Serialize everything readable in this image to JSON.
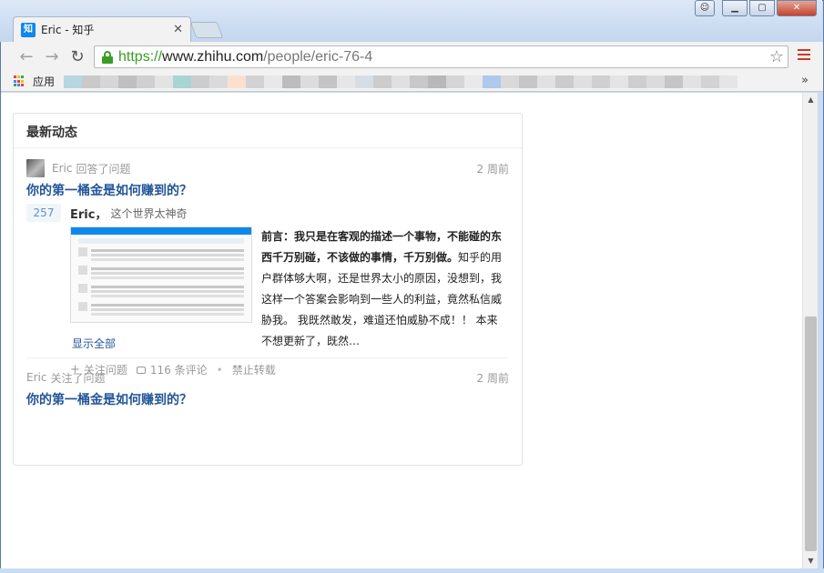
{
  "browser": {
    "tab_title": "Eric - 知乎",
    "tab_favicon": "知",
    "url_scheme": "https://",
    "url_host": "www.zhihu.com",
    "url_path": "/people/eric-76-4",
    "bookmarks_apps_label": "应用",
    "colors": {
      "secure": "#3a9d23",
      "accent": "#0f88eb",
      "menu": "#d0362a"
    }
  },
  "card": {
    "title": "最新动态",
    "items": [
      {
        "user": "Eric",
        "action": "回答了问题",
        "time": "2 周前",
        "question": "你的第一桶金是如何赚到的？",
        "votes": "257",
        "author": "Eric，",
        "author_bio": "这个世界太神奇",
        "answer_bold": "前言：我只是在客观的描述一个事物，不能碰的东西千万别碰，不该做的事情，千万别做。",
        "answer_text": "知乎的用户群体够大啊，还是世界太小的原因，没想到，我这样一个答案会影响到一些人的利益，竟然私信威胁我。 我既然敢发，难道还怕威胁不成！！ 本来不想更新了，既然…",
        "show_all": "显示全部",
        "follow_label": "关注问题",
        "comments_label": "116 条评论",
        "no_repost_label": "禁止转载"
      },
      {
        "user": "Eric",
        "action": "关注了问题",
        "time": "2 周前",
        "question": "你的第一桶金是如何赚到的？"
      }
    ]
  }
}
